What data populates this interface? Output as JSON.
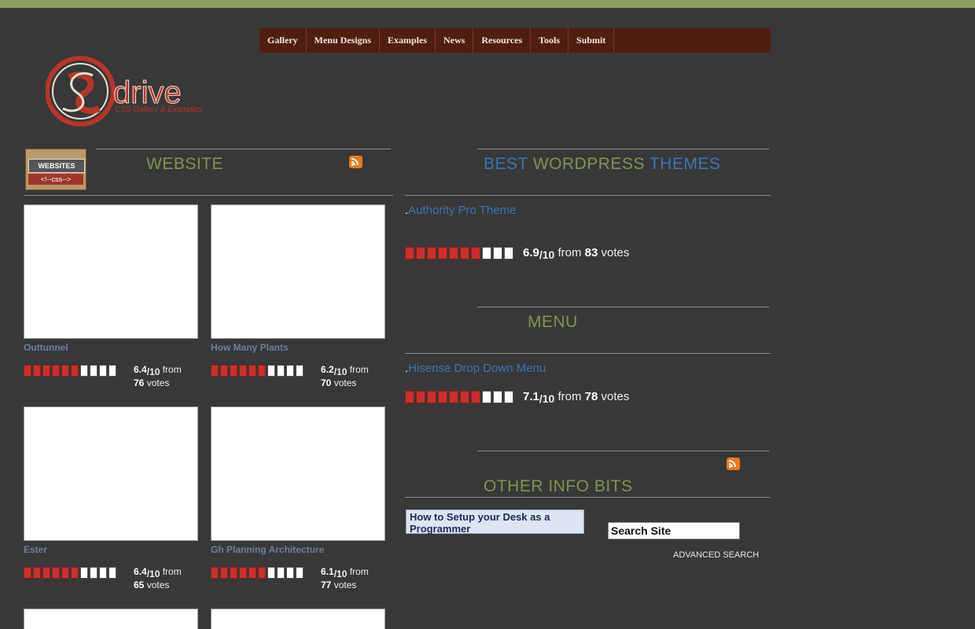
{
  "nav": {
    "items": [
      "Gallery",
      "Menu Designs",
      "Examples",
      "News",
      "Resources",
      "Tools",
      "Submit"
    ]
  },
  "logo": {
    "letters": "drive",
    "tagline": "CSS Gallery & Examples"
  },
  "badge": {
    "top": "WEBSITES",
    "bottom": "<!--css-->"
  },
  "website_section": {
    "heading": "WEBSITE",
    "cards": [
      {
        "title": "Outtunnel",
        "score": "6.4",
        "denominator": "/10",
        "from": "from",
        "votes": "76",
        "votes_label": "votes",
        "filled": 6,
        "total": 10
      },
      {
        "title": "How Many Plants",
        "score": "6.2",
        "denominator": "/10",
        "from": "from",
        "votes": "70",
        "votes_label": "votes",
        "filled": 6,
        "total": 10
      },
      {
        "title": "Ester",
        "score": "6.4",
        "denominator": "/10",
        "from": "from",
        "votes": "65",
        "votes_label": "votes",
        "filled": 6,
        "total": 10
      },
      {
        "title": "Gh Planning Architecture",
        "score": "6.1",
        "denominator": "/10",
        "from": "from",
        "votes": "77",
        "votes_label": "votes",
        "filled": 6,
        "total": 10
      }
    ]
  },
  "themes_section": {
    "heading_a": "BEST",
    "heading_b": "WORDPRESS",
    "heading_c": "THEMES",
    "item": {
      "dot": ".",
      "title": "Authority Pro Theme",
      "score": "6.9",
      "denominator": "/10",
      "from": "from",
      "votes": "83",
      "votes_label": "votes",
      "filled": 7,
      "total": 10
    }
  },
  "menu_section": {
    "heading": "MENU",
    "item": {
      "dot": ".",
      "title": "Hisense Drop Down Menu",
      "score": "7.1",
      "denominator": "/10",
      "from": "from",
      "votes": "78",
      "votes_label": "votes",
      "filled": 7,
      "total": 10
    }
  },
  "info_section": {
    "heading": "OTHER INFO BITS",
    "article": "How to Setup your Desk as a Programmer",
    "search_value": "Search Site",
    "advanced": "ADVANCED SEARCH"
  },
  "colors": {
    "nav_bg": "#501e0e",
    "accent_green": "#7f9451",
    "link_blue": "#3d74b2",
    "rating_red": "#c8302c"
  }
}
